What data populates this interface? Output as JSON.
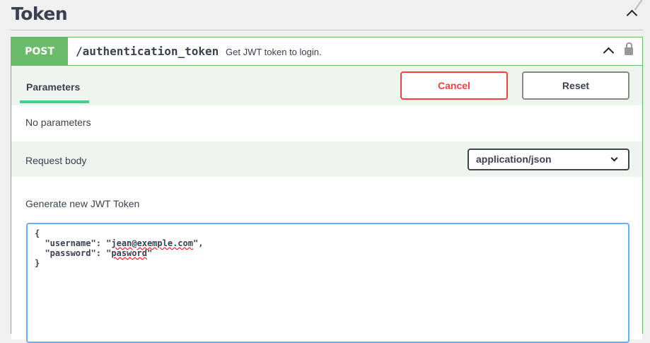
{
  "tag": {
    "title": "Token"
  },
  "operation": {
    "method": "POST",
    "path": "/authentication_token",
    "summary": "Get JWT token to login."
  },
  "tabs": {
    "parameters": "Parameters"
  },
  "buttons": {
    "cancel": "Cancel",
    "reset": "Reset"
  },
  "parameters": {
    "empty": "No parameters"
  },
  "request_body": {
    "label": "Request body",
    "content_type": "application/json",
    "description": "Generate new JWT Token",
    "lines": {
      "open": "{",
      "user_key": "  \"username\": \"",
      "user_val": "jean@exemple.com",
      "user_end": "\",",
      "pass_key": "  \"password\": \"",
      "pass_val": "pasword",
      "pass_end": "\"",
      "close": "}"
    }
  }
}
